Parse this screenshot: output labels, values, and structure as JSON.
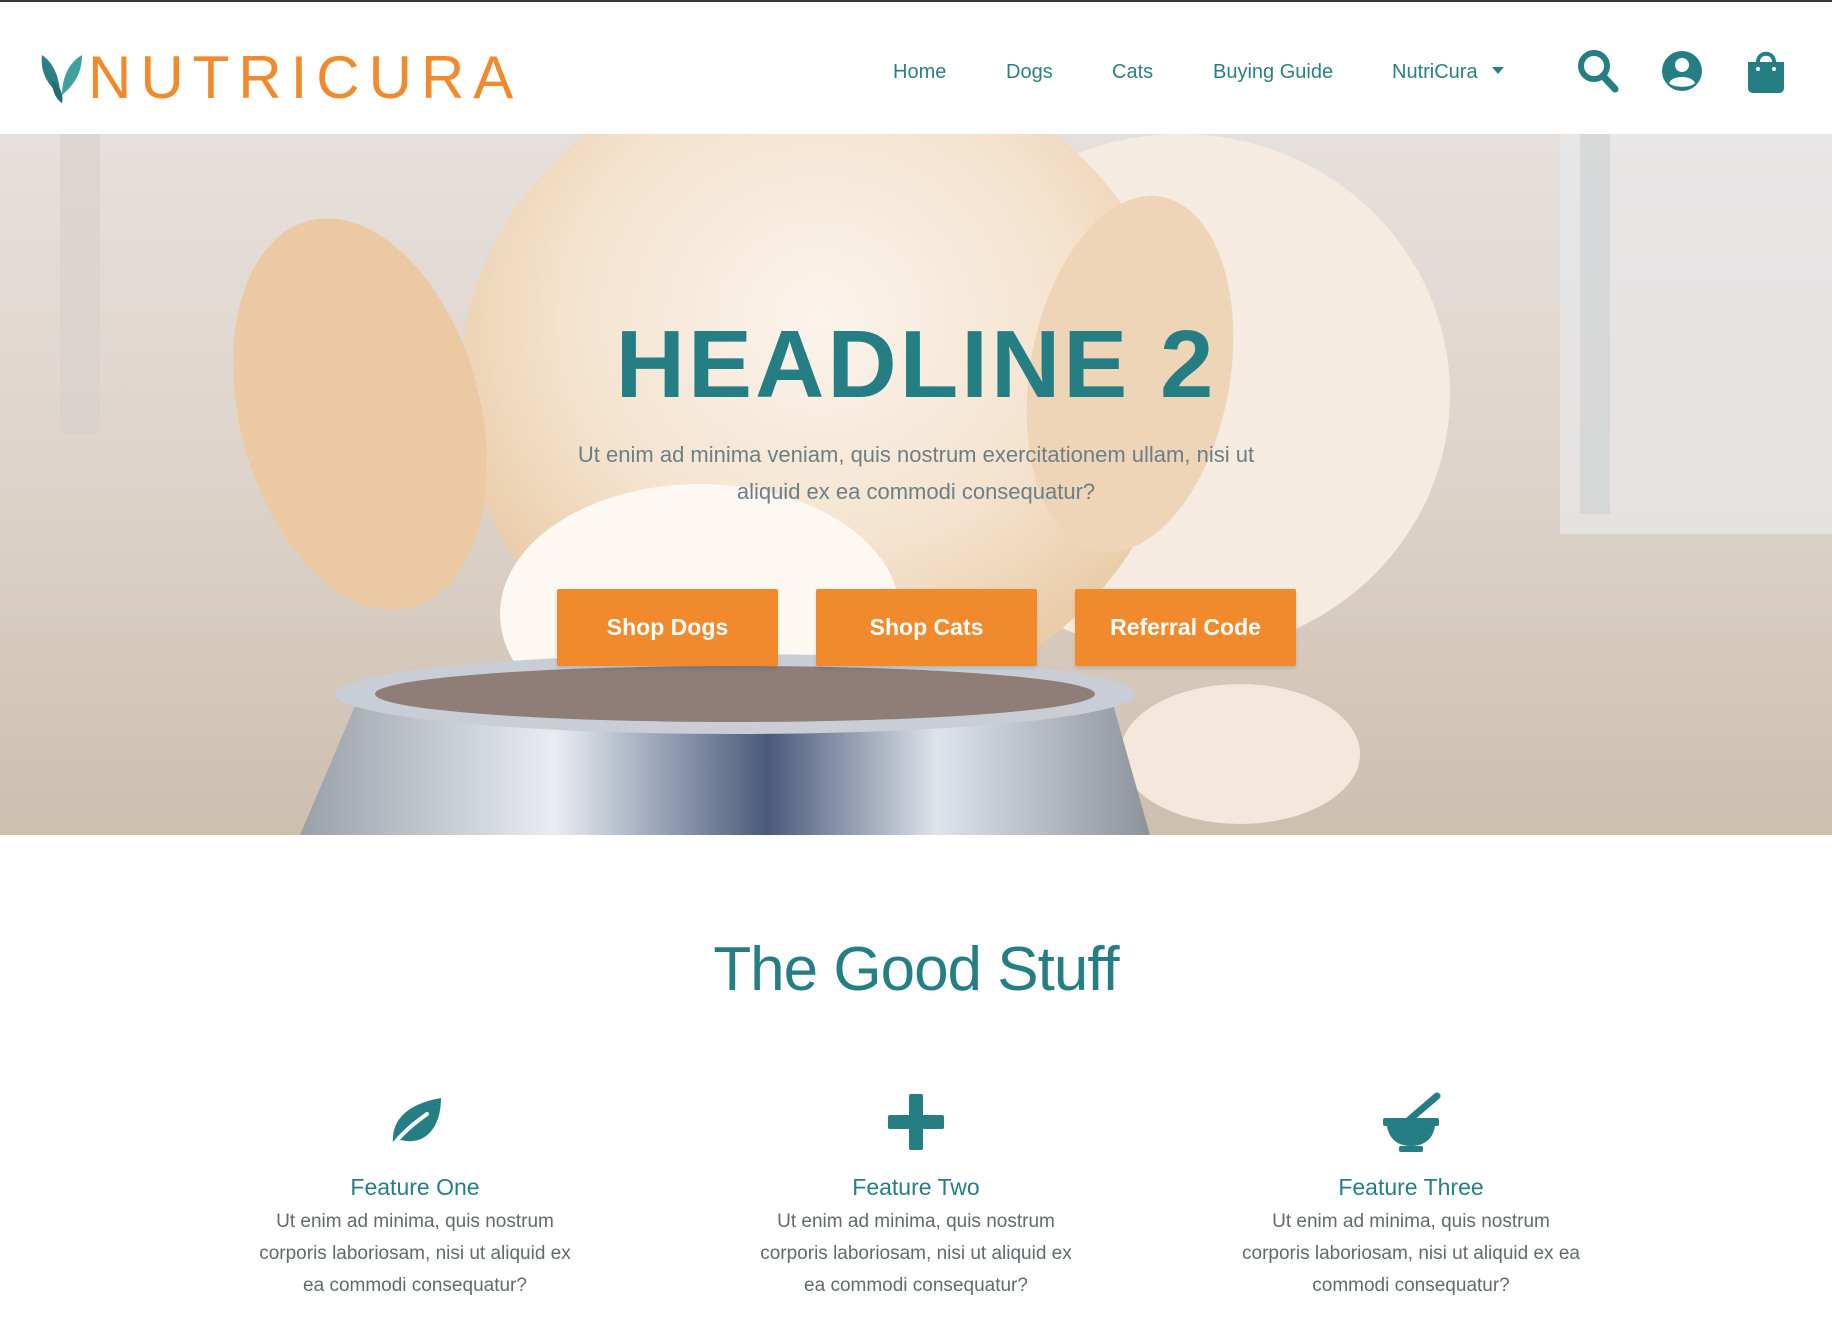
{
  "brand": {
    "name": "NUTRICURA",
    "logo_icon": "leaf-logo-icon",
    "colors": {
      "primary_teal": "#267e85",
      "accent_orange": "#f08a2c",
      "text_gray": "#616a6d"
    }
  },
  "nav": {
    "items": [
      {
        "label": "Home"
      },
      {
        "label": "Dogs"
      },
      {
        "label": "Cats"
      },
      {
        "label": "Buying Guide"
      },
      {
        "label": "NutriCura",
        "has_dropdown": true
      }
    ],
    "icons": [
      "search-icon",
      "account-icon",
      "shopping-bag-icon"
    ]
  },
  "hero": {
    "headline": "HEADLINE 2",
    "subtext": "Ut enim ad minima veniam, quis nostrum exercitationem ullam, nisi ut aliquid ex ea commodi consequatur?",
    "buttons": [
      {
        "label": "Shop Dogs"
      },
      {
        "label": "Shop Cats"
      },
      {
        "label": "Referral Code"
      }
    ]
  },
  "features_section": {
    "title": "The Good Stuff",
    "features": [
      {
        "icon": "leaf-icon",
        "title": "Feature One",
        "text": "Ut enim ad minima, quis nostrum corporis laboriosam, nisi ut aliquid ex ea commodi consequatur?"
      },
      {
        "icon": "plus-icon",
        "title": "Feature Two",
        "text": "Ut enim ad minima, quis nostrum corporis laboriosam, nisi ut aliquid ex ea commodi consequatur?"
      },
      {
        "icon": "mortar-pestle-icon",
        "title": "Feature Three",
        "text": "Ut enim ad minima, quis nostrum corporis laboriosam, nisi ut aliquid ex ea commodi consequatur?"
      }
    ]
  }
}
